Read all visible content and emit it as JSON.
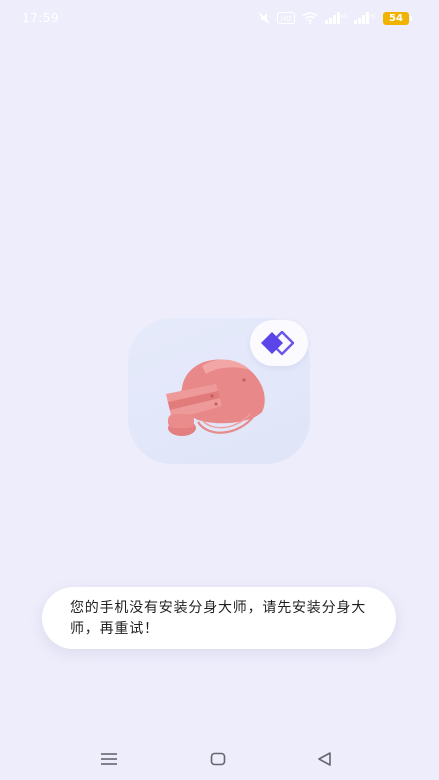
{
  "status_bar": {
    "time": "17:59",
    "battery_level": "54",
    "icons": [
      "mute-icon",
      "hd-icon",
      "wifi-icon",
      "signal-icon",
      "signal-icon",
      "battery-icon"
    ]
  },
  "app": {
    "icon_name": "helmet-icon",
    "badge_icon": "clone-diamond-icon",
    "accent_color": "#5b45e8"
  },
  "toast": {
    "message": "您的手机没有安装分身大师，请先安装分身大师，再重试！"
  },
  "nav": {
    "icons": [
      "menu-icon",
      "home-square-icon",
      "back-triangle-icon"
    ]
  }
}
